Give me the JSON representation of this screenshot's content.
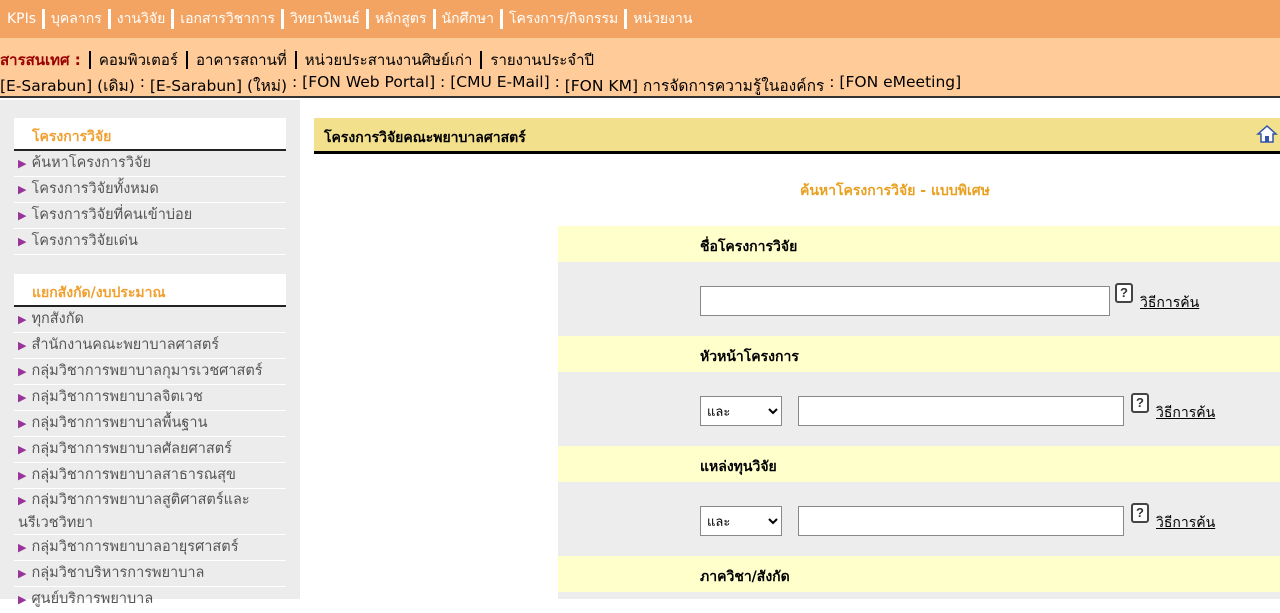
{
  "topnav": {
    "items": [
      "KPIs",
      "บุคลากร",
      "งานวิจัย",
      "เอกสารวิชาการ",
      "วิทยานิพนธ์",
      "หลักสูตร",
      "นักศึกษา",
      "โครงการ/กิจกรรม",
      "หน่วยงาน"
    ]
  },
  "infobar": {
    "label": "สารสนเทศ :",
    "items": [
      "คอมพิวเตอร์",
      "อาคารสถานที่",
      "หน่วยประสานงานศิษย์เก่า",
      "รายงานประจำปี"
    ],
    "links": [
      "[E-Sarabun] (เดิม)",
      "[E-Sarabun] (ใหม่)",
      "[FON Web Portal]",
      "[CMU E-Mail]",
      "[FON KM] การจัดการความรู้ในองค์กร",
      "[FON eMeeting]"
    ],
    "link_sep": " : "
  },
  "sidebar": {
    "box1": {
      "title": "โครงการวิจัย",
      "items": [
        "ค้นหาโครงการวิจัย",
        "โครงการวิจัยทั้งหมด",
        "โครงการวิจัยที่คนเข้าบ่อย",
        "โครงการวิจัยเด่น"
      ]
    },
    "box2": {
      "title": "แยกสังกัด/งบประมาณ",
      "items": [
        "ทุกสังกัด",
        "สำนักงานคณะพยาบาลศาสตร์",
        "กลุ่มวิชาการพยาบาลกุมารเวชศาสตร์",
        "กลุ่มวิชาการพยาบาลจิตเวช",
        "กลุ่มวิชาการพยาบาลพื้นฐาน",
        "กลุ่มวิชาการพยาบาลศัลยศาสตร์",
        "กลุ่มวิชาการพยาบาลสาธารณสุข",
        "กลุ่มวิชาการพยาบาลสูติศาสตร์และนรีเวชวิทยา",
        "กลุ่มวิชาการพยาบาลอายุรศาสตร์",
        "กลุ่มวิชาบริหารการพยาบาล",
        "ศูนย์บริการพยาบาล"
      ]
    }
  },
  "main": {
    "header_title": "โครงการวิจัยคณะพยาบาลศาสตร์",
    "subtitle": "ค้นหาโครงการวิจัย - แบบพิเศษ",
    "help_text": "วิธีการค้น",
    "help_glyph": "?",
    "fields": [
      {
        "label": "ชื่อโครงการวิจัย",
        "value": ""
      },
      {
        "label": "หัวหน้าโครงการ",
        "operator": "และ",
        "value": ""
      },
      {
        "label": "แหล่งทุนวิจัย",
        "operator": "และ",
        "value": ""
      },
      {
        "label": "ภาควิชา/สังกัด"
      }
    ]
  },
  "colors": {
    "topnav_bg": "#f4a462",
    "infobar_bg": "#ffcc99",
    "sidebar_bg": "#ececec",
    "header_bg": "#f2e08c",
    "accent_text": "#e8a020",
    "bullet": "#993399"
  }
}
